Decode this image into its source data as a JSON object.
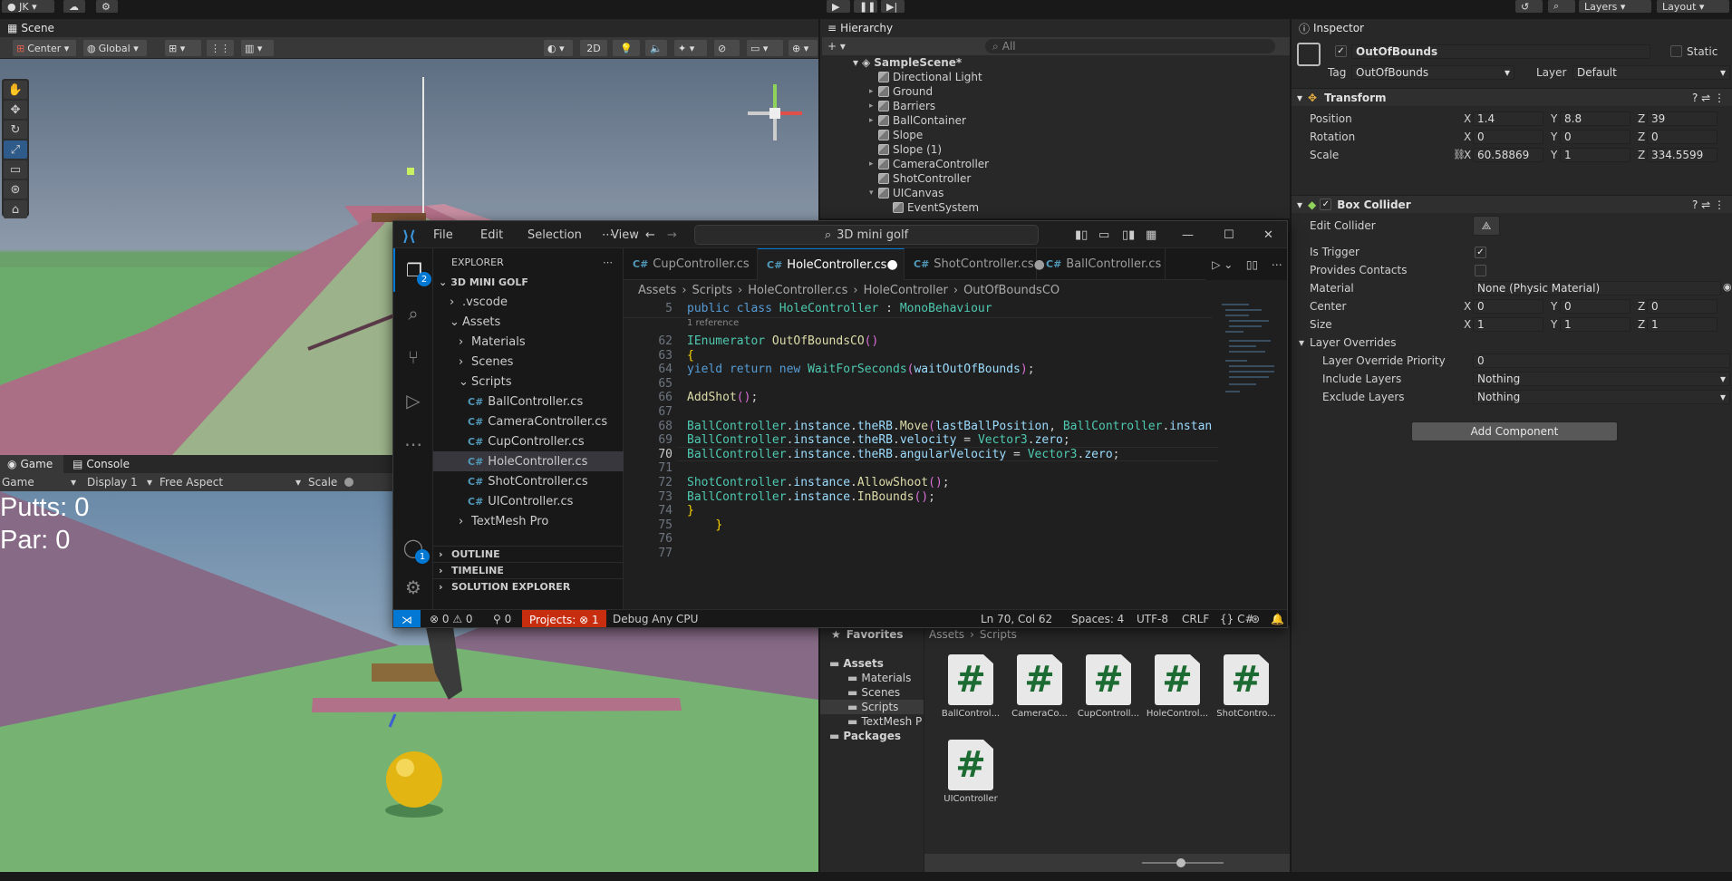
{
  "unity": {
    "account_label": "JK",
    "layers_label": "Layers",
    "layout_label": "Layout",
    "scene_tab": "Scene",
    "scene_toolbar": {
      "pivot": "Center",
      "space": "Global",
      "mode_2d": "2D"
    },
    "game_tab": "Game",
    "console_tab": "Console",
    "game_toolbar": {
      "display_type": "Game",
      "display": "Display 1",
      "aspect": "Free Aspect",
      "scale_label": "Scale"
    },
    "game_hud": {
      "putts": "Putts: 0",
      "par": "Par: 0"
    },
    "hierarchy": {
      "tab": "Hierarchy",
      "search_placeholder": "All",
      "scene_name": "SampleScene*",
      "items": [
        {
          "label": "Directional Light",
          "expandable": false
        },
        {
          "label": "Ground",
          "expandable": true
        },
        {
          "label": "Barriers",
          "expandable": true
        },
        {
          "label": "BallContainer",
          "expandable": true
        },
        {
          "label": "Slope",
          "expandable": false
        },
        {
          "label": "Slope (1)",
          "expandable": false
        },
        {
          "label": "CameraController",
          "expandable": true
        },
        {
          "label": "ShotController",
          "expandable": false
        },
        {
          "label": "UICanvas",
          "expandable": true
        },
        {
          "label": "EventSystem",
          "expandable": false
        }
      ]
    },
    "project": {
      "favorites_label": "Favorites",
      "breadcrumb": [
        "Assets",
        "Scripts"
      ],
      "tree": [
        {
          "label": "Assets",
          "level": 0
        },
        {
          "label": "Materials",
          "level": 1
        },
        {
          "label": "Scenes",
          "level": 1
        },
        {
          "label": "Scripts",
          "level": 1
        },
        {
          "label": "TextMesh P",
          "level": 1
        },
        {
          "label": "Packages",
          "level": 0
        }
      ],
      "assets": [
        "BallControl...",
        "CameraCo...",
        "CupControll...",
        "HoleControl...",
        "ShotContro...",
        "UIController"
      ]
    },
    "inspector": {
      "tab": "Inspector",
      "object_name": "OutOfBounds",
      "static_label": "Static",
      "tag_label": "Tag",
      "tag_value": "OutOfBounds",
      "layer_label": "Layer",
      "layer_value": "Default",
      "transform": {
        "title": "Transform",
        "position": {
          "label": "Position",
          "x": "1.4",
          "y": "8.8",
          "z": "39"
        },
        "rotation": {
          "label": "Rotation",
          "x": "0",
          "y": "0",
          "z": "0"
        },
        "scale": {
          "label": "Scale",
          "x": "60.58869",
          "y": "1",
          "z": "334.5599"
        }
      },
      "box_collider": {
        "title": "Box Collider",
        "edit_collider": "Edit Collider",
        "is_trigger": "Is Trigger",
        "provides_contacts": "Provides Contacts",
        "material_label": "Material",
        "material_value": "None (Physic Material)",
        "center": {
          "label": "Center",
          "x": "0",
          "y": "0",
          "z": "0"
        },
        "size": {
          "label": "Size",
          "x": "1",
          "y": "1",
          "z": "1"
        },
        "layer_overrides": "Layer Overrides",
        "priority_label": "Layer Override Priority",
        "priority_value": "0",
        "include_label": "Include Layers",
        "include_value": "Nothing",
        "exclude_label": "Exclude Layers",
        "exclude_value": "Nothing"
      },
      "add_component": "Add Component"
    }
  },
  "vscode": {
    "menus": [
      "File",
      "Edit",
      "Selection",
      "View"
    ],
    "search": "3D mini golf",
    "explorer": {
      "title": "EXPLORER",
      "root": "3D MINI GOLF",
      "rows": [
        {
          "label": ".vscode",
          "type": "folder",
          "level": 1,
          "open": false
        },
        {
          "label": "Assets",
          "type": "folder",
          "level": 1,
          "open": true
        },
        {
          "label": "Materials",
          "type": "folder",
          "level": 2,
          "open": false
        },
        {
          "label": "Scenes",
          "type": "folder",
          "level": 2,
          "open": false
        },
        {
          "label": "Scripts",
          "type": "folder",
          "level": 2,
          "open": true
        },
        {
          "label": "BallController.cs",
          "type": "cs",
          "level": 3
        },
        {
          "label": "CameraController.cs",
          "type": "cs",
          "level": 3
        },
        {
          "label": "CupController.cs",
          "type": "cs",
          "level": 3
        },
        {
          "label": "HoleController.cs",
          "type": "cs",
          "level": 3,
          "selected": true
        },
        {
          "label": "ShotController.cs",
          "type": "cs",
          "level": 3
        },
        {
          "label": "UIController.cs",
          "type": "cs",
          "level": 3
        },
        {
          "label": "TextMesh Pro",
          "type": "folder",
          "level": 2,
          "open": false
        }
      ],
      "sections": [
        "OUTLINE",
        "TIMELINE",
        "SOLUTION EXPLORER"
      ]
    },
    "badges": {
      "explorer": "2",
      "accounts": "1"
    },
    "tabs": [
      {
        "label": "CupController.cs",
        "modified": false,
        "active": false
      },
      {
        "label": "HoleController.cs",
        "modified": true,
        "active": true
      },
      {
        "label": "ShotController.cs",
        "modified": true,
        "active": false
      },
      {
        "label": "BallController.cs",
        "modified": false,
        "active": false
      }
    ],
    "breadcrumb": [
      "Assets",
      "Scripts",
      "HoleController.cs",
      "HoleController",
      "OutOfBoundsCO"
    ],
    "sticky_line": {
      "num": "5",
      "text": "public class HoleController : MonoBehaviour"
    },
    "codelens": "1 reference",
    "code_lines": [
      {
        "num": "62",
        "text": "IEnumerator OutOfBoundsCO()"
      },
      {
        "num": "63",
        "text": "{"
      },
      {
        "num": "64",
        "text": "yield return new WaitForSeconds(waitOutOfBounds);"
      },
      {
        "num": "65",
        "text": ""
      },
      {
        "num": "66",
        "text": "AddShot();"
      },
      {
        "num": "67",
        "text": ""
      },
      {
        "num": "68",
        "text": "BallController.instance.theRB.Move(lastBallPosition, BallController.instan"
      },
      {
        "num": "69",
        "text": "BallController.instance.theRB.velocity = Vector3.zero;"
      },
      {
        "num": "70",
        "text": "BallController.instance.theRB.angularVelocity = Vector3.zero;"
      },
      {
        "num": "71",
        "text": ""
      },
      {
        "num": "72",
        "text": "ShotController.instance.AllowShoot();"
      },
      {
        "num": "73",
        "text": "BallController.instance.InBounds();"
      },
      {
        "num": "74",
        "text": "}"
      },
      {
        "num": "75",
        "text": "    }"
      },
      {
        "num": "76",
        "text": ""
      },
      {
        "num": "77",
        "text": ""
      }
    ],
    "status": {
      "errors": "0",
      "warnings": "0",
      "ports": "0",
      "projects": "Projects: ⊗ 1",
      "debug": "Debug Any CPU",
      "position": "Ln 70, Col 62",
      "spaces": "Spaces: 4",
      "encoding": "UTF-8",
      "eol": "CRLF",
      "language": "C#"
    }
  },
  "colors": {
    "vscode_blue": "#0078d4",
    "error_red": "#c72e0f",
    "unity_panel": "#282828"
  }
}
